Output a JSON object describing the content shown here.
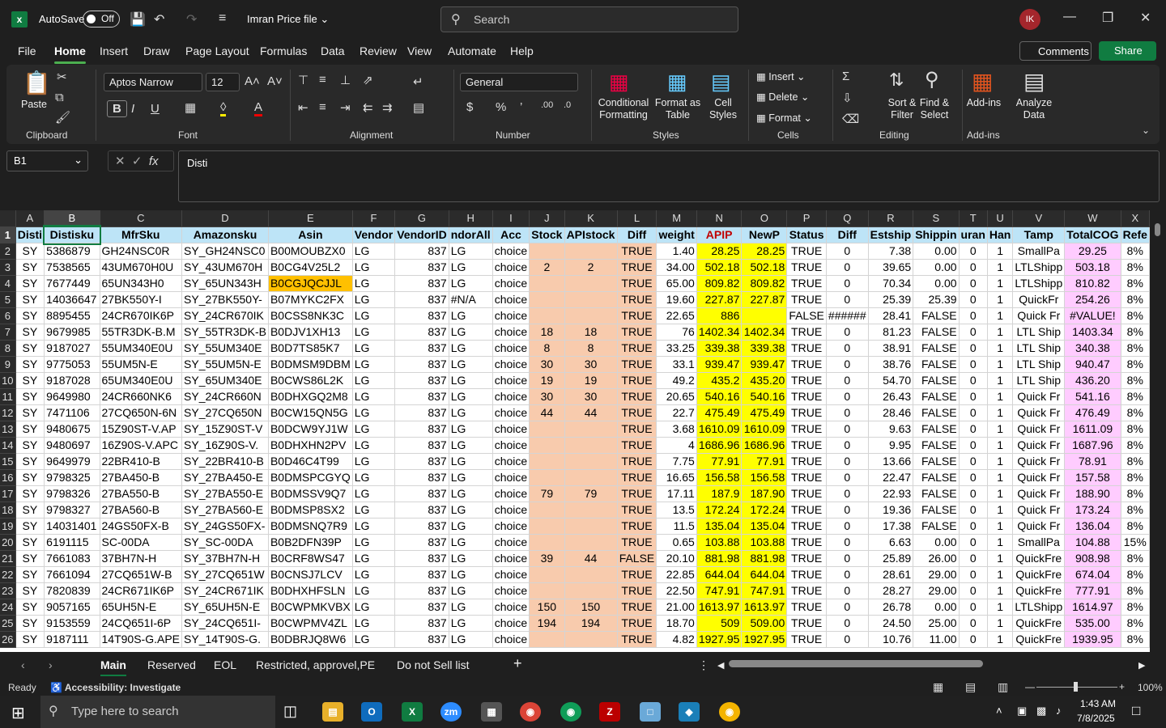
{
  "window": {
    "autosave": "AutoSave",
    "toggle": "Off",
    "filename": "Imran Price file",
    "search_placeholder": "Search",
    "avatar": "IK"
  },
  "menu": [
    "File",
    "Home",
    "Insert",
    "Draw",
    "Page Layout",
    "Formulas",
    "Data",
    "Review",
    "View",
    "Automate",
    "Help"
  ],
  "actions": {
    "comments": "Comments",
    "share": "Share"
  },
  "ribbon": {
    "paste": "Paste",
    "clipboard": "Clipboard",
    "font_name": "Aptos Narrow",
    "font_size": "12",
    "font": "Font",
    "alignment": "Alignment",
    "number_format": "General",
    "number": "Number",
    "cond_format": "Conditional Formatting",
    "format_table": "Format as Table",
    "cell_styles": "Cell Styles",
    "styles": "Styles",
    "insert": "Insert",
    "delete": "Delete",
    "format": "Format",
    "cells": "Cells",
    "sort_filter": "Sort & Filter",
    "find_select": "Find & Select",
    "editing": "Editing",
    "addins": "Add-ins",
    "addins_group": "Add-ins",
    "analyze": "Analyze Data"
  },
  "formula": {
    "namebox": "B1",
    "content": "Disti"
  },
  "columns": [
    "A",
    "B",
    "C",
    "D",
    "E",
    "F",
    "G",
    "H",
    "I",
    "J",
    "K",
    "L",
    "M",
    "N",
    "O",
    "P",
    "Q",
    "R",
    "S",
    "T",
    "U",
    "V",
    "W",
    "X"
  ],
  "headers": [
    "Disti",
    "Distisku",
    "MfrSku",
    "Amazonsku",
    "Asin",
    "Vendor",
    "VendorID",
    "ndorAll",
    "Acc",
    "Stock",
    "APIstock",
    "Diff",
    "weight",
    "APIP",
    "NewP",
    "Status",
    "Diff",
    "Estship",
    "Shippin",
    "uran",
    "Han",
    "Tamp",
    "TotalCOG",
    "Refe"
  ],
  "rows": [
    [
      "SY",
      "5386879",
      "GH24NSC0R",
      "SY_GH24NSC0",
      "B00MOUBZX0",
      "LG",
      "837",
      "LG",
      "choice",
      "",
      "",
      "TRUE",
      "1.40",
      "28.25",
      "28.25",
      "TRUE",
      "0",
      "7.38",
      "0.00",
      "0",
      "1",
      "SmallPa",
      "29.25",
      "8%"
    ],
    [
      "SY",
      "7538565",
      "43UM670H0U",
      "SY_43UM670H",
      "B0CG4V25L2",
      "LG",
      "837",
      "LG",
      "choice",
      "2",
      "2",
      "TRUE",
      "34.00",
      "502.18",
      "502.18",
      "TRUE",
      "0",
      "39.65",
      "0.00",
      "0",
      "1",
      "LTLShipp",
      "503.18",
      "8%"
    ],
    [
      "SY",
      "7677449",
      "65UN343H0",
      "SY_65UN343H",
      "B0CGJQCJJL",
      "LG",
      "837",
      "LG",
      "choice",
      "",
      "",
      "TRUE",
      "65.00",
      "809.82",
      "809.82",
      "TRUE",
      "0",
      "70.34",
      "0.00",
      "0",
      "1",
      "LTLShipp",
      "810.82",
      "8%"
    ],
    [
      "SY",
      "14036647",
      "27BK550Y-I",
      "SY_27BK550Y-",
      "B07MYKC2FX",
      "LG",
      "837",
      "#N/A",
      "choice",
      "",
      "",
      "TRUE",
      "19.60",
      "227.87",
      "227.87",
      "TRUE",
      "0",
      "25.39",
      "25.39",
      "0",
      "1",
      "QuickFr",
      "254.26",
      "8%"
    ],
    [
      "SY",
      "8895455",
      "24CR670IK6P",
      "SY_24CR670IK",
      "B0CSS8NK3C",
      "LG",
      "837",
      "LG",
      "choice",
      "",
      "",
      "TRUE",
      "22.65",
      "886",
      "",
      "FALSE",
      "######",
      "28.41",
      "FALSE",
      "0",
      "1",
      "Quick Fr",
      "#VALUE!",
      "8%"
    ],
    [
      "SY",
      "9679985",
      "55TR3DK-B.M",
      "SY_55TR3DK-B",
      "B0DJV1XH13",
      "LG",
      "837",
      "LG",
      "choice",
      "18",
      "18",
      "TRUE",
      "76",
      "1402.34",
      "1402.34",
      "TRUE",
      "0",
      "81.23",
      "FALSE",
      "0",
      "1",
      "LTL Ship",
      "1403.34",
      "8%"
    ],
    [
      "SY",
      "9187027",
      "55UM340E0U",
      "SY_55UM340E",
      "B0D7TS85K7",
      "LG",
      "837",
      "LG",
      "choice",
      "8",
      "8",
      "TRUE",
      "33.25",
      "339.38",
      "339.38",
      "TRUE",
      "0",
      "38.91",
      "FALSE",
      "0",
      "1",
      "LTL Ship",
      "340.38",
      "8%"
    ],
    [
      "SY",
      "9775053",
      "55UM5N-E",
      "SY_55UM5N-E",
      "B0DMSM9DBM",
      "LG",
      "837",
      "LG",
      "choice",
      "30",
      "30",
      "TRUE",
      "33.1",
      "939.47",
      "939.47",
      "TRUE",
      "0",
      "38.76",
      "FALSE",
      "0",
      "1",
      "LTL Ship",
      "940.47",
      "8%"
    ],
    [
      "SY",
      "9187028",
      "65UM340E0U",
      "SY_65UM340E",
      "B0CWS86L2K",
      "LG",
      "837",
      "LG",
      "choice",
      "19",
      "19",
      "TRUE",
      "49.2",
      "435.2",
      "435.20",
      "TRUE",
      "0",
      "54.70",
      "FALSE",
      "0",
      "1",
      "LTL Ship",
      "436.20",
      "8%"
    ],
    [
      "SY",
      "9649980",
      "24CR660NK6",
      "SY_24CR660N",
      "B0DHXGQ2M8",
      "LG",
      "837",
      "LG",
      "choice",
      "30",
      "30",
      "TRUE",
      "20.65",
      "540.16",
      "540.16",
      "TRUE",
      "0",
      "26.43",
      "FALSE",
      "0",
      "1",
      "Quick Fr",
      "541.16",
      "8%"
    ],
    [
      "SY",
      "7471106",
      "27CQ650N-6N",
      "SY_27CQ650N",
      "B0CW15QN5G",
      "LG",
      "837",
      "LG",
      "choice",
      "44",
      "44",
      "TRUE",
      "22.7",
      "475.49",
      "475.49",
      "TRUE",
      "0",
      "28.46",
      "FALSE",
      "0",
      "1",
      "Quick Fr",
      "476.49",
      "8%"
    ],
    [
      "SY",
      "9480675",
      "15Z90ST-V.AP",
      "SY_15Z90ST-V",
      "B0DCW9YJ1W",
      "LG",
      "837",
      "LG",
      "choice",
      "",
      "",
      "TRUE",
      "3.68",
      "1610.09",
      "1610.09",
      "TRUE",
      "0",
      "9.63",
      "FALSE",
      "0",
      "1",
      "Quick Fr",
      "1611.09",
      "8%"
    ],
    [
      "SY",
      "9480697",
      "16Z90S-V.APC",
      "SY_16Z90S-V.",
      "B0DHXHN2PV",
      "LG",
      "837",
      "LG",
      "choice",
      "",
      "",
      "TRUE",
      "4",
      "1686.96",
      "1686.96",
      "TRUE",
      "0",
      "9.95",
      "FALSE",
      "0",
      "1",
      "Quick Fr",
      "1687.96",
      "8%"
    ],
    [
      "SY",
      "9649979",
      "22BR410-B",
      "SY_22BR410-B",
      "B0D46C4T99",
      "LG",
      "837",
      "LG",
      "choice",
      "",
      "",
      "TRUE",
      "7.75",
      "77.91",
      "77.91",
      "TRUE",
      "0",
      "13.66",
      "FALSE",
      "0",
      "1",
      "Quick Fr",
      "78.91",
      "8%"
    ],
    [
      "SY",
      "9798325",
      "27BA450-B",
      "SY_27BA450-E",
      "B0DMSPCGYQ",
      "LG",
      "837",
      "LG",
      "choice",
      "",
      "",
      "TRUE",
      "16.65",
      "156.58",
      "156.58",
      "TRUE",
      "0",
      "22.47",
      "FALSE",
      "0",
      "1",
      "Quick Fr",
      "157.58",
      "8%"
    ],
    [
      "SY",
      "9798326",
      "27BA550-B",
      "SY_27BA550-E",
      "B0DMSSV9Q7",
      "LG",
      "837",
      "LG",
      "choice",
      "79",
      "79",
      "TRUE",
      "17.11",
      "187.9",
      "187.90",
      "TRUE",
      "0",
      "22.93",
      "FALSE",
      "0",
      "1",
      "Quick Fr",
      "188.90",
      "8%"
    ],
    [
      "SY",
      "9798327",
      "27BA560-B",
      "SY_27BA560-E",
      "B0DMSP8SX2",
      "LG",
      "837",
      "LG",
      "choice",
      "",
      "",
      "TRUE",
      "13.5",
      "172.24",
      "172.24",
      "TRUE",
      "0",
      "19.36",
      "FALSE",
      "0",
      "1",
      "Quick Fr",
      "173.24",
      "8%"
    ],
    [
      "SY",
      "14031401",
      "24GS50FX-B",
      "SY_24GS50FX-",
      "B0DMSNQ7R9",
      "LG",
      "837",
      "LG",
      "choice",
      "",
      "",
      "TRUE",
      "11.5",
      "135.04",
      "135.04",
      "TRUE",
      "0",
      "17.38",
      "FALSE",
      "0",
      "1",
      "Quick Fr",
      "136.04",
      "8%"
    ],
    [
      "SY",
      "6191115",
      "SC-00DA",
      "SY_SC-00DA",
      "B0B2DFN39P",
      "LG",
      "837",
      "LG",
      "choice",
      "",
      "",
      "TRUE",
      "0.65",
      "103.88",
      "103.88",
      "TRUE",
      "0",
      "6.63",
      "0.00",
      "0",
      "1",
      "SmallPa",
      "104.88",
      "15%"
    ],
    [
      "SY",
      "7661083",
      "37BH7N-H",
      "SY_37BH7N-H",
      "B0CRF8WS47",
      "LG",
      "837",
      "LG",
      "choice",
      "39",
      "44",
      "FALSE",
      "20.10",
      "881.98",
      "881.98",
      "TRUE",
      "0",
      "25.89",
      "26.00",
      "0",
      "1",
      "QuickFre",
      "908.98",
      "8%"
    ],
    [
      "SY",
      "7661094",
      "27CQ651W-B",
      "SY_27CQ651W",
      "B0CNSJ7LCV",
      "LG",
      "837",
      "LG",
      "choice",
      "",
      "",
      "TRUE",
      "22.85",
      "644.04",
      "644.04",
      "TRUE",
      "0",
      "28.61",
      "29.00",
      "0",
      "1",
      "QuickFre",
      "674.04",
      "8%"
    ],
    [
      "SY",
      "7820839",
      "24CR671IK6P",
      "SY_24CR671IK",
      "B0DHXHFSLN",
      "LG",
      "837",
      "LG",
      "choice",
      "",
      "",
      "TRUE",
      "22.50",
      "747.91",
      "747.91",
      "TRUE",
      "0",
      "28.27",
      "29.00",
      "0",
      "1",
      "QuickFre",
      "777.91",
      "8%"
    ],
    [
      "SY",
      "9057165",
      "65UH5N-E",
      "SY_65UH5N-E",
      "B0CWPMKVBX",
      "LG",
      "837",
      "LG",
      "choice",
      "150",
      "150",
      "TRUE",
      "21.00",
      "1613.97",
      "1613.97",
      "TRUE",
      "0",
      "26.78",
      "0.00",
      "0",
      "1",
      "LTLShipp",
      "1614.97",
      "8%"
    ],
    [
      "SY",
      "9153559",
      "24CQ651I-6P",
      "SY_24CQ651I-",
      "B0CWPMV4ZL",
      "LG",
      "837",
      "LG",
      "choice",
      "194",
      "194",
      "TRUE",
      "18.70",
      "509",
      "509.00",
      "TRUE",
      "0",
      "24.50",
      "25.00",
      "0",
      "1",
      "QuickFre",
      "535.00",
      "8%"
    ],
    [
      "SY",
      "9187111",
      "14T90S-G.APE",
      "SY_14T90S-G.",
      "B0DBRJQ8W6",
      "LG",
      "837",
      "LG",
      "choice",
      "",
      "",
      "TRUE",
      "4.82",
      "1927.95",
      "1927.95",
      "TRUE",
      "0",
      "10.76",
      "11.00",
      "0",
      "1",
      "QuickFre",
      "1939.95",
      "8%"
    ]
  ],
  "sheets": [
    "Main",
    "Reserved",
    "EOL",
    "Restricted, approvel,PE",
    "Do not Sell list"
  ],
  "status": {
    "ready": "Ready",
    "accessibility": "Accessibility: Investigate",
    "zoom": "100%"
  },
  "taskbar": {
    "search": "Type here to search",
    "time": "1:43 AM",
    "date": "7/8/2025"
  }
}
